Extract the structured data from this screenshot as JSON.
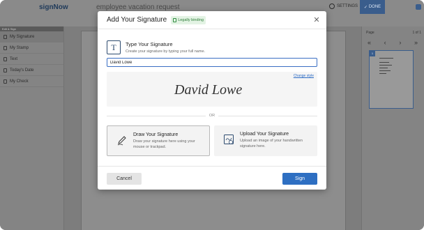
{
  "app": {
    "brand": "signNow",
    "document_title": "employee vacation request",
    "settings_label": "SETTINGS",
    "done_label": "DONE"
  },
  "left_panel": {
    "header": "Edit & Sign",
    "items": [
      {
        "label": "My Signature",
        "icon": "signature-icon"
      },
      {
        "label": "My Stamp",
        "icon": "stamp-icon"
      },
      {
        "label": "Text",
        "icon": "text-icon"
      },
      {
        "label": "Today's Date",
        "icon": "calendar-icon"
      },
      {
        "label": "My Check",
        "icon": "check-icon"
      }
    ]
  },
  "right_panel": {
    "page_label": "Page",
    "page_count": "1 of 1",
    "thumbnail_number": "1"
  },
  "modal": {
    "title": "Add Your Signature",
    "badge": "Legally binding",
    "type_section": {
      "title": "Type Your Signature",
      "subtitle": "Create your signature by typing your full name."
    },
    "name_value": "David Lowe",
    "change_style": "Change style",
    "signature_preview": "David Lowe",
    "or_text": "OR",
    "draw_card": {
      "title": "Draw Your Signature",
      "subtitle": "Draw your signature here using your mouse or trackpad."
    },
    "upload_card": {
      "title": "Upload Your Signature",
      "subtitle": "Upload an image of your handwritten signature here."
    },
    "cancel_label": "Cancel",
    "sign_label": "Sign"
  },
  "colors": {
    "primary": "#2e6fc2",
    "badge_green": "#2e7d38",
    "overlay_gray": "#7d7d7d"
  }
}
